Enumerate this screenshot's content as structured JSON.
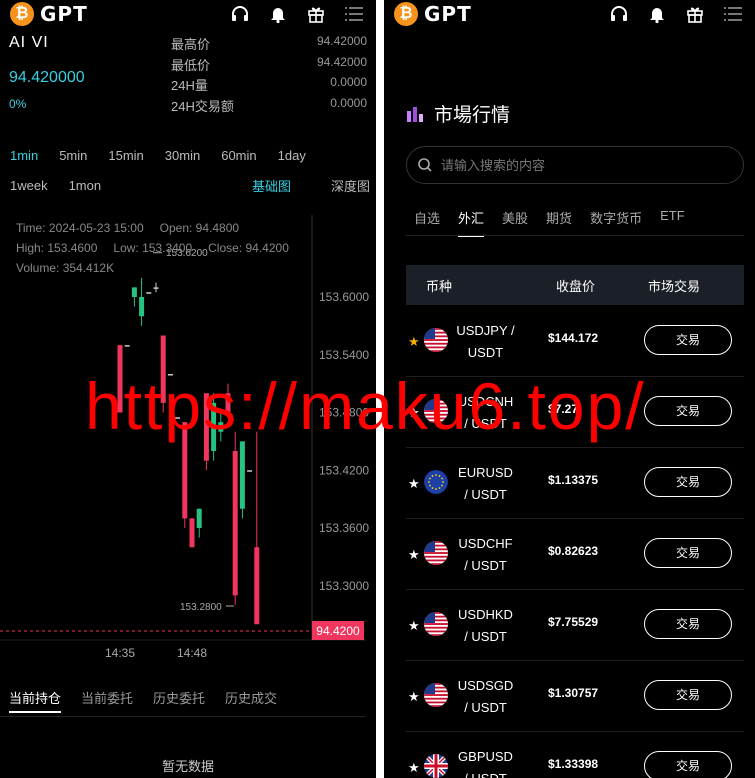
{
  "brand": {
    "name": "GPT",
    "coin_glyph": "₿"
  },
  "left": {
    "symbol": "AI VI",
    "price": "94.420000",
    "change_pct": "0%",
    "stats": [
      {
        "label": "最高价",
        "value": "94.42000"
      },
      {
        "label": "最低价",
        "value": "94.42000"
      },
      {
        "label": "24H量",
        "value": "0.0000"
      },
      {
        "label": "24H交易额",
        "value": "0.0000"
      }
    ],
    "intervals_row1": [
      "1min",
      "5min",
      "15min",
      "30min",
      "60min",
      "1day"
    ],
    "intervals_row2": [
      "1week",
      "1mon"
    ],
    "active_interval": "1min",
    "view_basic": "基础图",
    "view_depth": "深度图",
    "ohlc": {
      "time": "Time: 2024-05-23 15:00",
      "open": "Open: 94.4800",
      "high": "High: 153.4600",
      "low": "Low: 153.3400",
      "close": "Close: 94.4200",
      "volume": "Volume: 354.412K"
    },
    "tabs": [
      "当前持仓",
      "当前委托",
      "历史委托",
      "历史成交"
    ],
    "empty_text": "暂无数据"
  },
  "chart_data": {
    "type": "candlestick",
    "y_ticks": [
      "153.6000",
      "153.5400",
      "153.4800",
      "153.4200",
      "153.3600",
      "153.3000"
    ],
    "y_tick_values": [
      153.6,
      153.54,
      153.48,
      153.42,
      153.36,
      153.3
    ],
    "x_ticks": [
      "14:35",
      "14:48"
    ],
    "max_label": "153.6200",
    "min_label": "153.2800",
    "last_price_label": "94.4200",
    "up_color": "#26c281",
    "down_color": "#f0365e",
    "candles": [
      {
        "o": 153.55,
        "h": 153.55,
        "l": 153.48,
        "c": 153.48
      },
      {
        "o": 153.55,
        "h": 153.55,
        "l": 153.55,
        "c": 153.55
      },
      {
        "o": 153.6,
        "h": 153.61,
        "l": 153.59,
        "c": 153.61
      },
      {
        "o": 153.58,
        "h": 153.62,
        "l": 153.57,
        "c": 153.6
      },
      {
        "o": 153.605,
        "h": 153.605,
        "l": 153.605,
        "c": 153.605
      },
      {
        "o": 153.61,
        "h": 153.615,
        "l": 153.605,
        "c": 153.61
      },
      {
        "o": 153.56,
        "h": 153.56,
        "l": 153.48,
        "c": 153.49
      },
      {
        "o": 153.52,
        "h": 153.52,
        "l": 153.52,
        "c": 153.52
      },
      {
        "o": 153.475,
        "h": 153.475,
        "l": 153.475,
        "c": 153.475
      },
      {
        "o": 153.47,
        "h": 153.47,
        "l": 153.36,
        "c": 153.37
      },
      {
        "o": 153.37,
        "h": 153.37,
        "l": 153.34,
        "c": 153.34
      },
      {
        "o": 153.36,
        "h": 153.38,
        "l": 153.35,
        "c": 153.38
      },
      {
        "o": 153.5,
        "h": 153.5,
        "l": 153.42,
        "c": 153.43
      },
      {
        "o": 153.44,
        "h": 153.5,
        "l": 153.43,
        "c": 153.49
      },
      {
        "o": 153.46,
        "h": 153.48,
        "l": 153.45,
        "c": 153.47
      },
      {
        "o": 153.5,
        "h": 153.51,
        "l": 153.49,
        "c": 153.48
      },
      {
        "o": 153.44,
        "h": 153.46,
        "l": 153.28,
        "c": 153.29
      },
      {
        "o": 153.38,
        "h": 153.45,
        "l": 153.37,
        "c": 153.45
      },
      {
        "o": 153.42,
        "h": 153.42,
        "l": 153.42,
        "c": 153.42
      },
      {
        "o": 153.34,
        "h": 153.46,
        "l": 153.28,
        "c": 153.26
      }
    ]
  },
  "right": {
    "title": "市場行情",
    "search_placeholder": "请输入搜索的内容",
    "tabs": [
      "自选",
      "外汇",
      "美股",
      "期货",
      "数字货币",
      "ETF"
    ],
    "active_tab": "外汇",
    "columns": [
      "币种",
      "收盘价",
      "市场交易"
    ],
    "trade_label": "交易",
    "rows": [
      {
        "pair_line1": "USDJPY /",
        "pair_line2": "USDT",
        "price": "$144.172",
        "starred": true,
        "flag": "us"
      },
      {
        "pair_line1": "USDCNH",
        "pair_line2": "/ USDT",
        "price": "$7.27",
        "starred": false,
        "flag": "us"
      },
      {
        "pair_line1": "EURUSD",
        "pair_line2": "/ USDT",
        "price": "$1.13375",
        "starred": false,
        "flag": "eu"
      },
      {
        "pair_line1": "USDCHF",
        "pair_line2": "/ USDT",
        "price": "$0.82623",
        "starred": false,
        "flag": "us"
      },
      {
        "pair_line1": "USDHKD",
        "pair_line2": "/ USDT",
        "price": "$7.75529",
        "starred": false,
        "flag": "us"
      },
      {
        "pair_line1": "USDSGD",
        "pair_line2": "/ USDT",
        "price": "$1.30757",
        "starred": false,
        "flag": "us"
      },
      {
        "pair_line1": "GBPUSD",
        "pair_line2": "/ USDT",
        "price": "$1.33398",
        "starred": false,
        "flag": "gb"
      }
    ]
  },
  "watermark": "https://maku6.top/"
}
